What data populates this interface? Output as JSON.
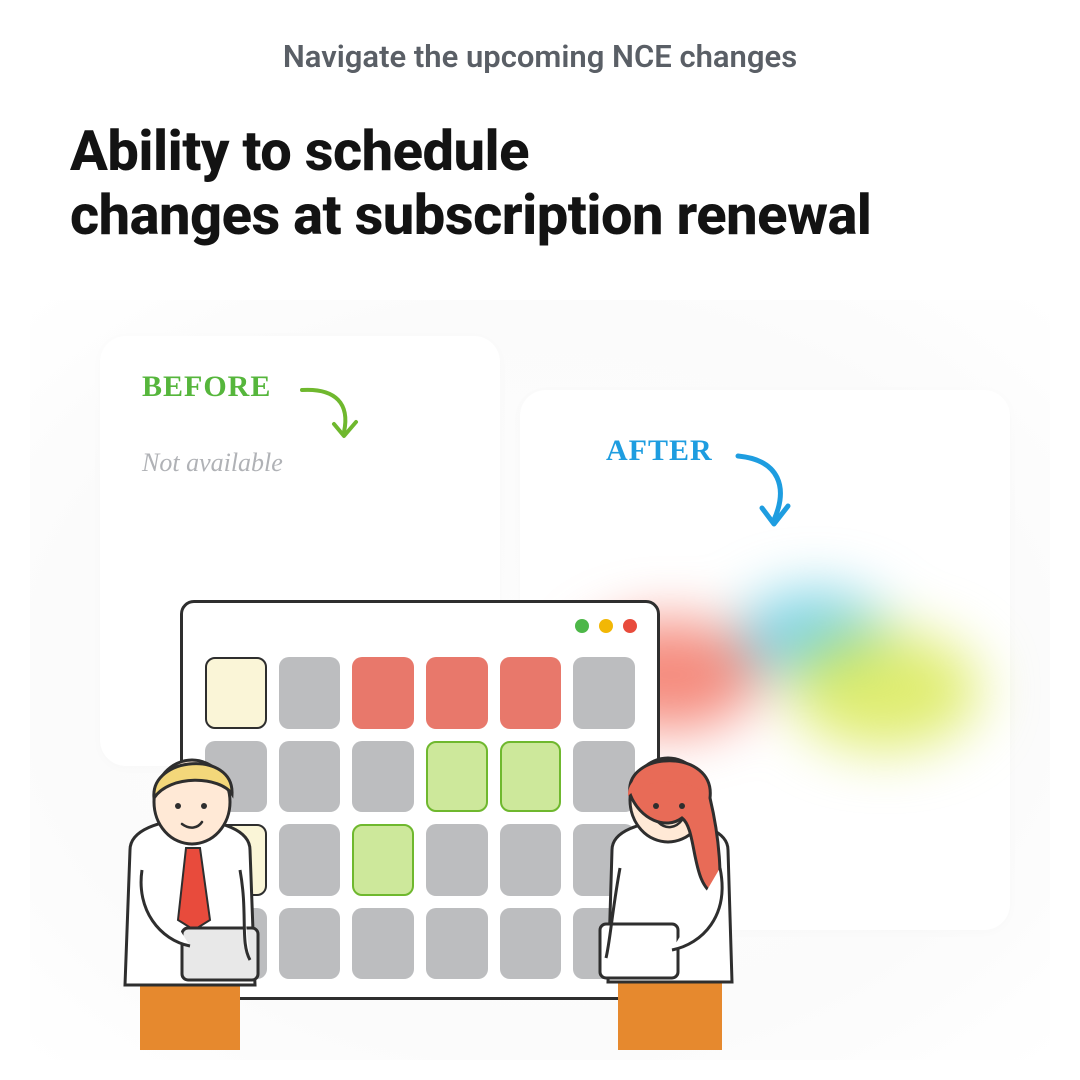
{
  "eyebrow": "Navigate the upcoming NCE changes",
  "headline_line1": "Ability to schedule",
  "headline_line2": "changes at subscription renewal",
  "cards": {
    "before": {
      "label": "BEFORE",
      "status": "Not available"
    },
    "after": {
      "label": "AFTER"
    }
  },
  "colors": {
    "before_accent": "#56b63c",
    "after_accent": "#1e9de0"
  },
  "calendar_grid": [
    [
      "cream",
      "gray",
      "red",
      "red",
      "red",
      "gray"
    ],
    [
      "gray",
      "gray",
      "gray",
      "green",
      "green",
      "gray"
    ],
    [
      "cream",
      "gray",
      "green",
      "gray",
      "gray",
      "gray"
    ],
    [
      "gray",
      "gray",
      "gray",
      "gray",
      "gray",
      "gray"
    ]
  ]
}
